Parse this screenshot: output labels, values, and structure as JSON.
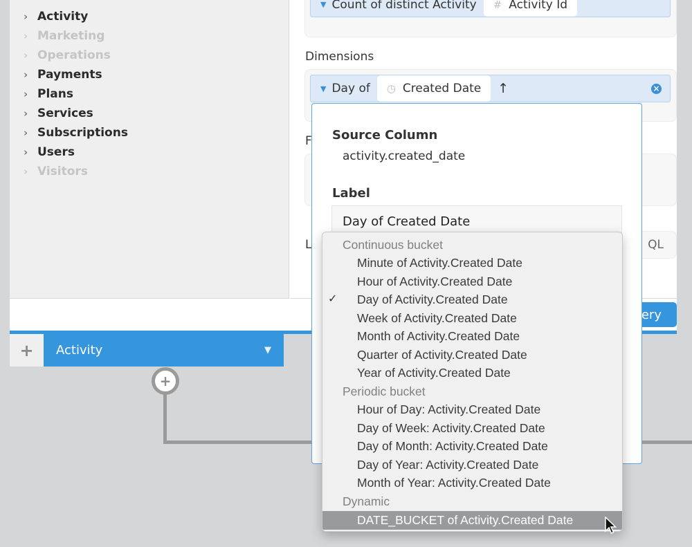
{
  "sidebar": {
    "items": [
      {
        "label": "Activity",
        "enabled": true
      },
      {
        "label": "Marketing",
        "enabled": false
      },
      {
        "label": "Operations",
        "enabled": false
      },
      {
        "label": "Payments",
        "enabled": true
      },
      {
        "label": "Plans",
        "enabled": true
      },
      {
        "label": "Services",
        "enabled": true
      },
      {
        "label": "Subscriptions",
        "enabled": true
      },
      {
        "label": "Users",
        "enabled": true
      },
      {
        "label": "Visitors",
        "enabled": false
      }
    ]
  },
  "measures": {
    "pill_prefix": "Count of distinct Activity",
    "field_icon": "#",
    "field": "Activity Id"
  },
  "dimensions": {
    "title": "Dimensions",
    "pill_prefix": "Day of",
    "field_icon": "clock-icon",
    "field": "Created Date",
    "sort_arrow": "↑",
    "remove_icon": "×"
  },
  "hidden_labels": {
    "filters_initial": "F",
    "limit_initial": "L",
    "sql_suffix": "QL",
    "run_suffix": "ery"
  },
  "popover": {
    "source_column_title": "Source Column",
    "source_column_value": "activity.created_date",
    "label_title": "Label",
    "label_value": "Day of Created Date"
  },
  "menu": {
    "groups": [
      {
        "title": "Continuous bucket",
        "items": [
          {
            "label": "Minute of Activity.Created Date",
            "checked": false
          },
          {
            "label": "Hour of Activity.Created Date",
            "checked": false
          },
          {
            "label": "Day of Activity.Created Date",
            "checked": true
          },
          {
            "label": "Week of Activity.Created Date",
            "checked": false
          },
          {
            "label": "Month of Activity.Created Date",
            "checked": false
          },
          {
            "label": "Quarter of Activity.Created Date",
            "checked": false
          },
          {
            "label": "Year of Activity.Created Date",
            "checked": false
          }
        ]
      },
      {
        "title": "Periodic bucket",
        "items": [
          {
            "label": "Hour of Day: Activity.Created Date",
            "checked": false
          },
          {
            "label": "Day of Week: Activity.Created Date",
            "checked": false
          },
          {
            "label": "Day of Month: Activity.Created Date",
            "checked": false
          },
          {
            "label": "Day of Year: Activity.Created Date",
            "checked": false
          },
          {
            "label": "Month of Year: Activity.Created Date",
            "checked": false
          }
        ]
      },
      {
        "title": "Dynamic",
        "items": [
          {
            "label": "DATE_BUCKET of Activity.Created Date",
            "checked": false,
            "hovered": true
          }
        ]
      }
    ],
    "check_glyph": "✓"
  },
  "tabs": {
    "add": "+",
    "active": "Activity",
    "dropdown_glyph": "▼"
  },
  "node": {
    "add": "+"
  },
  "colors": {
    "accent": "#3696dd",
    "pill_bg": "#dde9f6",
    "hover": "#999a9d"
  }
}
